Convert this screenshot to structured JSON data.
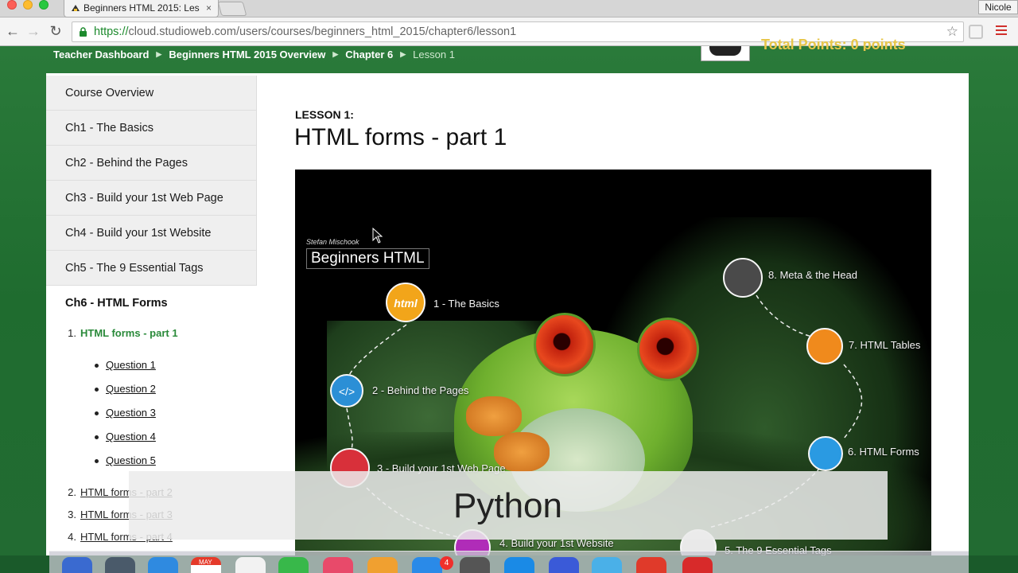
{
  "browser": {
    "tab_title": "Beginners HTML 2015: Les",
    "tab_close": "×",
    "profile_name": "Nicole",
    "url_protocol": "https://",
    "url_rest": "cloud.studioweb.com/users/courses/beginners_html_2015/chapter6/lesson1",
    "icons": [
      "back-icon",
      "forward-icon",
      "reload-icon",
      "lock-icon",
      "star-icon",
      "menu-icon"
    ]
  },
  "header": {
    "breadcrumbs": [
      "Teacher Dashboard",
      "Beginners HTML 2015 Overview",
      "Chapter 6"
    ],
    "breadcrumb_current": "Lesson 1",
    "points": "Total Points: 0 points"
  },
  "sidebar": {
    "items": [
      "Course Overview",
      "Ch1 - The Basics",
      "Ch2 - Behind the Pages",
      "Ch3 - Build your 1st Web Page",
      "Ch4 - Build your 1st Website",
      "Ch5 - The 9 Essential Tags"
    ],
    "active_chapter": "Ch6 - HTML Forms",
    "lessons": [
      {
        "num": "1.",
        "label": "HTML forms - part 1"
      },
      {
        "num": "2.",
        "label": "HTML forms - part 2"
      },
      {
        "num": "3.",
        "label": "HTML forms - part 3"
      },
      {
        "num": "4.",
        "label": "HTML forms - part 4"
      }
    ],
    "questions": [
      "Question 1",
      "Question 2",
      "Question 3",
      "Question 4",
      "Question 5"
    ]
  },
  "main": {
    "lesson_label": "LESSON 1:",
    "lesson_title": "HTML forms - part 1"
  },
  "video": {
    "author": "Stefan Mischook",
    "course_name": "Beginners HTML",
    "stops": [
      {
        "label": "1 - The Basics",
        "glyph": "html",
        "color": "#f2a51a"
      },
      {
        "label": "2 - Behind the Pages",
        "glyph": "</>",
        "color": "#2b8fd6"
      },
      {
        "label": "3 - Build your 1st Web Page",
        "glyph": "",
        "color": "#d8303a"
      },
      {
        "label": "4. Build your 1st Website",
        "glyph": "",
        "color": "#b02cb8"
      },
      {
        "label": "5. The 9 Essential Tags",
        "glyph": "",
        "color": "#e9e9e9"
      },
      {
        "label": "6. HTML Forms",
        "glyph": "",
        "color": "#2a9ae2"
      },
      {
        "label": "7. HTML Tables",
        "glyph": "",
        "color": "#f08a1c"
      },
      {
        "label": "8. Meta & the Head",
        "glyph": "",
        "color": "#4a4a4a"
      }
    ],
    "overlay_text": "Python"
  },
  "dock": {
    "badge_count": "4",
    "calendar_month": "MAY",
    "colors": [
      "#3a6ad0",
      "#4a5a6a",
      "#2f8ae0",
      "#ffffff",
      "#f2f2f2",
      "#38b84a",
      "#e84a6a",
      "#f0a030",
      "#2a8ae8",
      "#555555",
      "#1a8ae6",
      "#3a5ad8",
      "#4ab0e8",
      "#e03a2a",
      "#d82a2a"
    ]
  },
  "accent_colors": {
    "page_green": "#2a7a3a",
    "active_lesson": "#2a8a3a",
    "points_gold": "#e7c64a"
  }
}
